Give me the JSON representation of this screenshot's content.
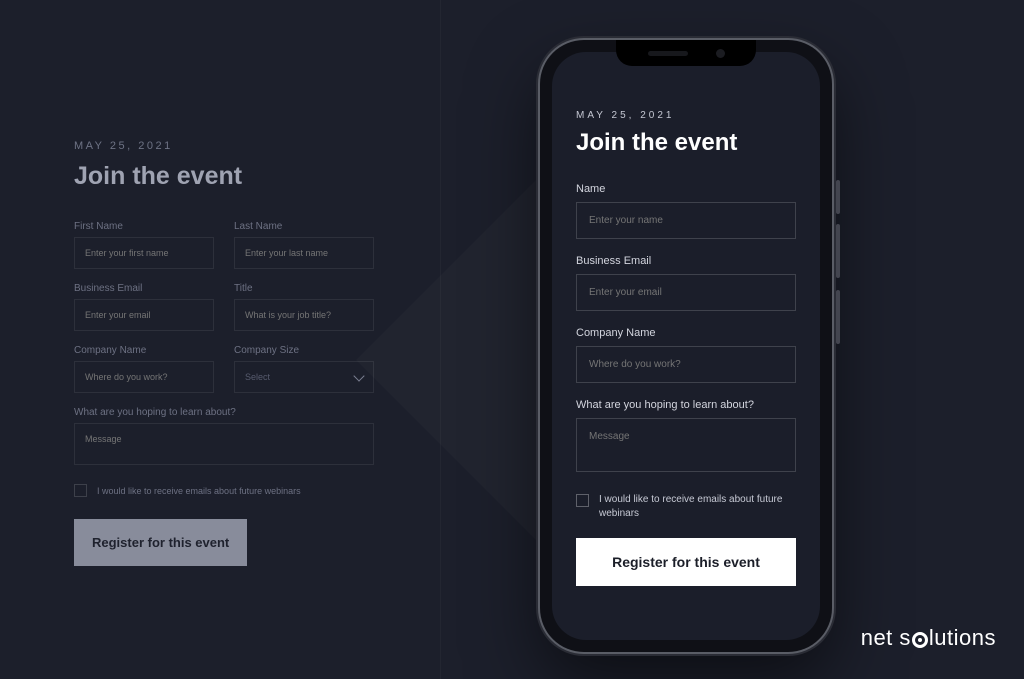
{
  "desktop": {
    "date": "MAY 25, 2021",
    "heading": "Join the event",
    "first_name_label": "First Name",
    "first_name_placeholder": "Enter your first name",
    "last_name_label": "Last Name",
    "last_name_placeholder": "Enter your last name",
    "email_label": "Business Email",
    "email_placeholder": "Enter your email",
    "title_label": "Title",
    "title_placeholder": "What is your job title?",
    "company_label": "Company Name",
    "company_placeholder": "Where do you work?",
    "size_label": "Company Size",
    "size_value": "Select",
    "topic_label": "What are you hoping to learn about?",
    "topic_placeholder": "Message",
    "consent_text": "I would like to receive emails about future webinars",
    "register_label": "Register for this event"
  },
  "mobile": {
    "date": "MAY 25, 2021",
    "heading": "Join the event",
    "name_label": "Name",
    "name_placeholder": "Enter your name",
    "email_label": "Business Email",
    "email_placeholder": "Enter your email",
    "company_label": "Company Name",
    "company_placeholder": "Where do you work?",
    "topic_label": "What are you hoping to learn about?",
    "topic_placeholder": "Message",
    "consent_text": "I would like to receive emails about future webinars",
    "register_label": "Register for this event"
  },
  "brand": {
    "part1": "net s",
    "part2": "lutions"
  }
}
